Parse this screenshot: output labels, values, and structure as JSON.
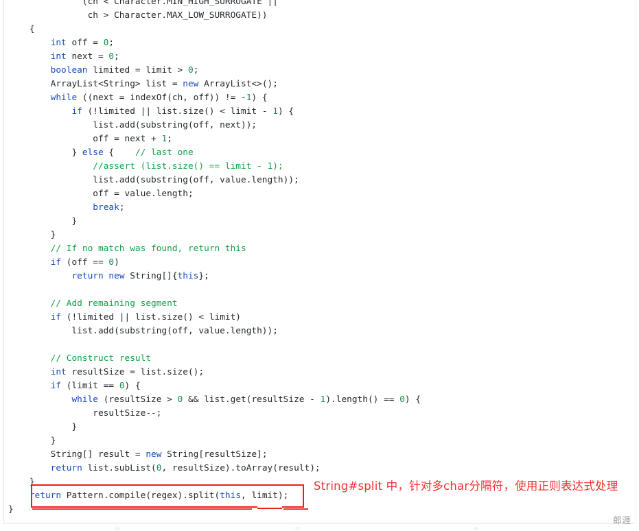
{
  "editor": {
    "language": "java",
    "background": "#ffffff",
    "colors": {
      "keyword": "#1749b8",
      "number": "#1a8c46",
      "comment": "#13a048",
      "plain": "#24292e",
      "annotation_red": "#f03030",
      "box_red": "#e81f1f",
      "watermark_gray": "#9a9a9a"
    },
    "lines": [
      "              (ch < Character.MIN_HIGH_SURROGATE ||",
      "               ch > Character.MAX_LOW_SURROGATE))",
      "    {",
      "        int off = 0;",
      "        int next = 0;",
      "        boolean limited = limit > 0;",
      "        ArrayList<String> list = new ArrayList<>();",
      "        while ((next = indexOf(ch, off)) != -1) {",
      "            if (!limited || list.size() < limit - 1) {",
      "                list.add(substring(off, next));",
      "                off = next + 1;",
      "            } else {    // last one",
      "                //assert (list.size() == limit - 1);",
      "                list.add(substring(off, value.length));",
      "                off = value.length;",
      "                break;",
      "            }",
      "        }",
      "        // If no match was found, return this",
      "        if (off == 0)",
      "            return new String[]{this};",
      "",
      "        // Add remaining segment",
      "        if (!limited || list.size() < limit)",
      "            list.add(substring(off, value.length));",
      "",
      "        // Construct result",
      "        int resultSize = list.size();",
      "        if (limit == 0) {",
      "            while (resultSize > 0 && list.get(resultSize - 1).length() == 0) {",
      "                resultSize--;",
      "            }",
      "        }",
      "        String[] result = new String[resultSize];",
      "        return list.subList(0, resultSize).toArray(result);",
      "    }",
      "    return Pattern.compile(regex).split(this, limit);",
      "}"
    ]
  },
  "highlight": {
    "boxed_line": "return Pattern.compile(regex).split(this, limit);",
    "box_color": "#e81f1f"
  },
  "annotation": {
    "text": "String#split 中，针对多char分隔符，使用正则表达式处理",
    "color": "#f03030"
  },
  "watermark": {
    "text": "郎涯"
  }
}
